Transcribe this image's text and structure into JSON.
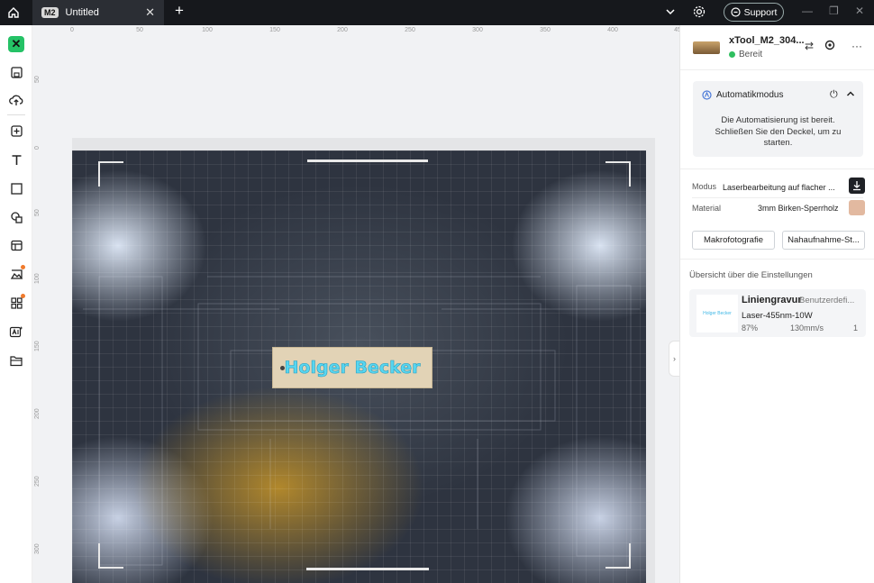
{
  "titlebar": {
    "tab_badge": "M2",
    "tab_title": "Untitled",
    "tab_close": "✕",
    "new_tab": "+",
    "support_label": "Support"
  },
  "ruler": {
    "top_ticks": [
      "0",
      "50",
      "100",
      "150",
      "200",
      "250",
      "300",
      "350",
      "400",
      "45"
    ],
    "left_ticks": [
      "50",
      "0",
      "50",
      "100",
      "150",
      "200",
      "250",
      "300"
    ]
  },
  "canvas": {
    "engraving_text": "Holger Becker"
  },
  "device": {
    "name": "xTool_M2_304...",
    "status": "Bereit",
    "status_color": "#2fbf5f"
  },
  "automation": {
    "title": "Automatikmodus",
    "message": "Die Automatisierung ist bereit. Schließen Sie den Deckel, um zu starten."
  },
  "settings": {
    "mode_label": "Modus",
    "mode_value": "Laserbearbeitung auf flacher ...",
    "material_label": "Material",
    "material_value": "3mm Birken-Sperrholz",
    "material_color": "#e2b9a0",
    "btn_macro": "Makrofotografie",
    "btn_closeup": "Nahaufnahme-St..."
  },
  "overview": {
    "title": "Übersicht über die Einstellungen",
    "card": {
      "thumb_text": "Holger Becker",
      "name": "Liniengravur",
      "preset": "Benutzerdefi...",
      "laser": "Laser-455nm-10W",
      "power": "87%",
      "speed": "130mm/s",
      "passes": "1"
    }
  },
  "colors": {
    "accent": "#2fbf5f",
    "engrave_text": "#58d6f0"
  }
}
